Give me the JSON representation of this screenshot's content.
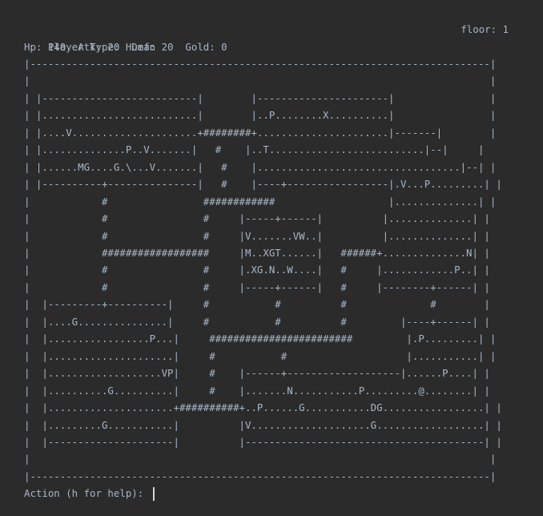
{
  "status": {
    "player_type": "Player Type: Human",
    "floor": "floor: 1",
    "stats": "Hp: 140  Atk: 20  Def: 20  Gold: 0"
  },
  "map": {
    "rows": [
      "|-----------------------------------------------------------------------------|",
      "|                                                                             |",
      "| |--------------------------|        |----------------------|                |",
      "| |..........................|        |..P........X..........|                |",
      "| |....V.....................+########+......................|-------|        |",
      "| |..............P..V.......|   #    |..T..........................|--|     |",
      "| |......MG....G.\\...V.......|   #    |..................................|--| |",
      "| |----------+---------------|   #    |----+-----------------|.V...P.........| |",
      "|            #                ############                   |..............| |",
      "|            #                #     |-----+------|          |..............| |",
      "|            #                #     |V.......VW..|          |..............| |",
      "|            ##################     |M..XGT......|   ######+..............N| |",
      "|            #                #     |.XG.N..W....|   #     |............P..| |",
      "|            #                #     |-----+------|   #     |--------+------| |",
      "|  |---------+----------|     #           #          #              #        |",
      "|  |....G...............|     #           #          #         |----+------| |",
      "|  |.................P...|     ########################         |.P.........| |",
      "|  |.....................|     #           #                    |...........| |",
      "|  |...................VP|     #    |------+-------------------|......P....| |",
      "|  |..........G..........|     #    |.......N...........P.........@........| |",
      "|  |.....................+##########+..P......G...........DG.................| |",
      "|  |.........G...........|          |V....................G..................| |",
      "|  |---------------------|          |----------------------------------------| |",
      "|                                                                             |",
      "|-----------------------------------------------------------------------------|"
    ]
  },
  "prompt": {
    "text": "Action (h for help): "
  }
}
